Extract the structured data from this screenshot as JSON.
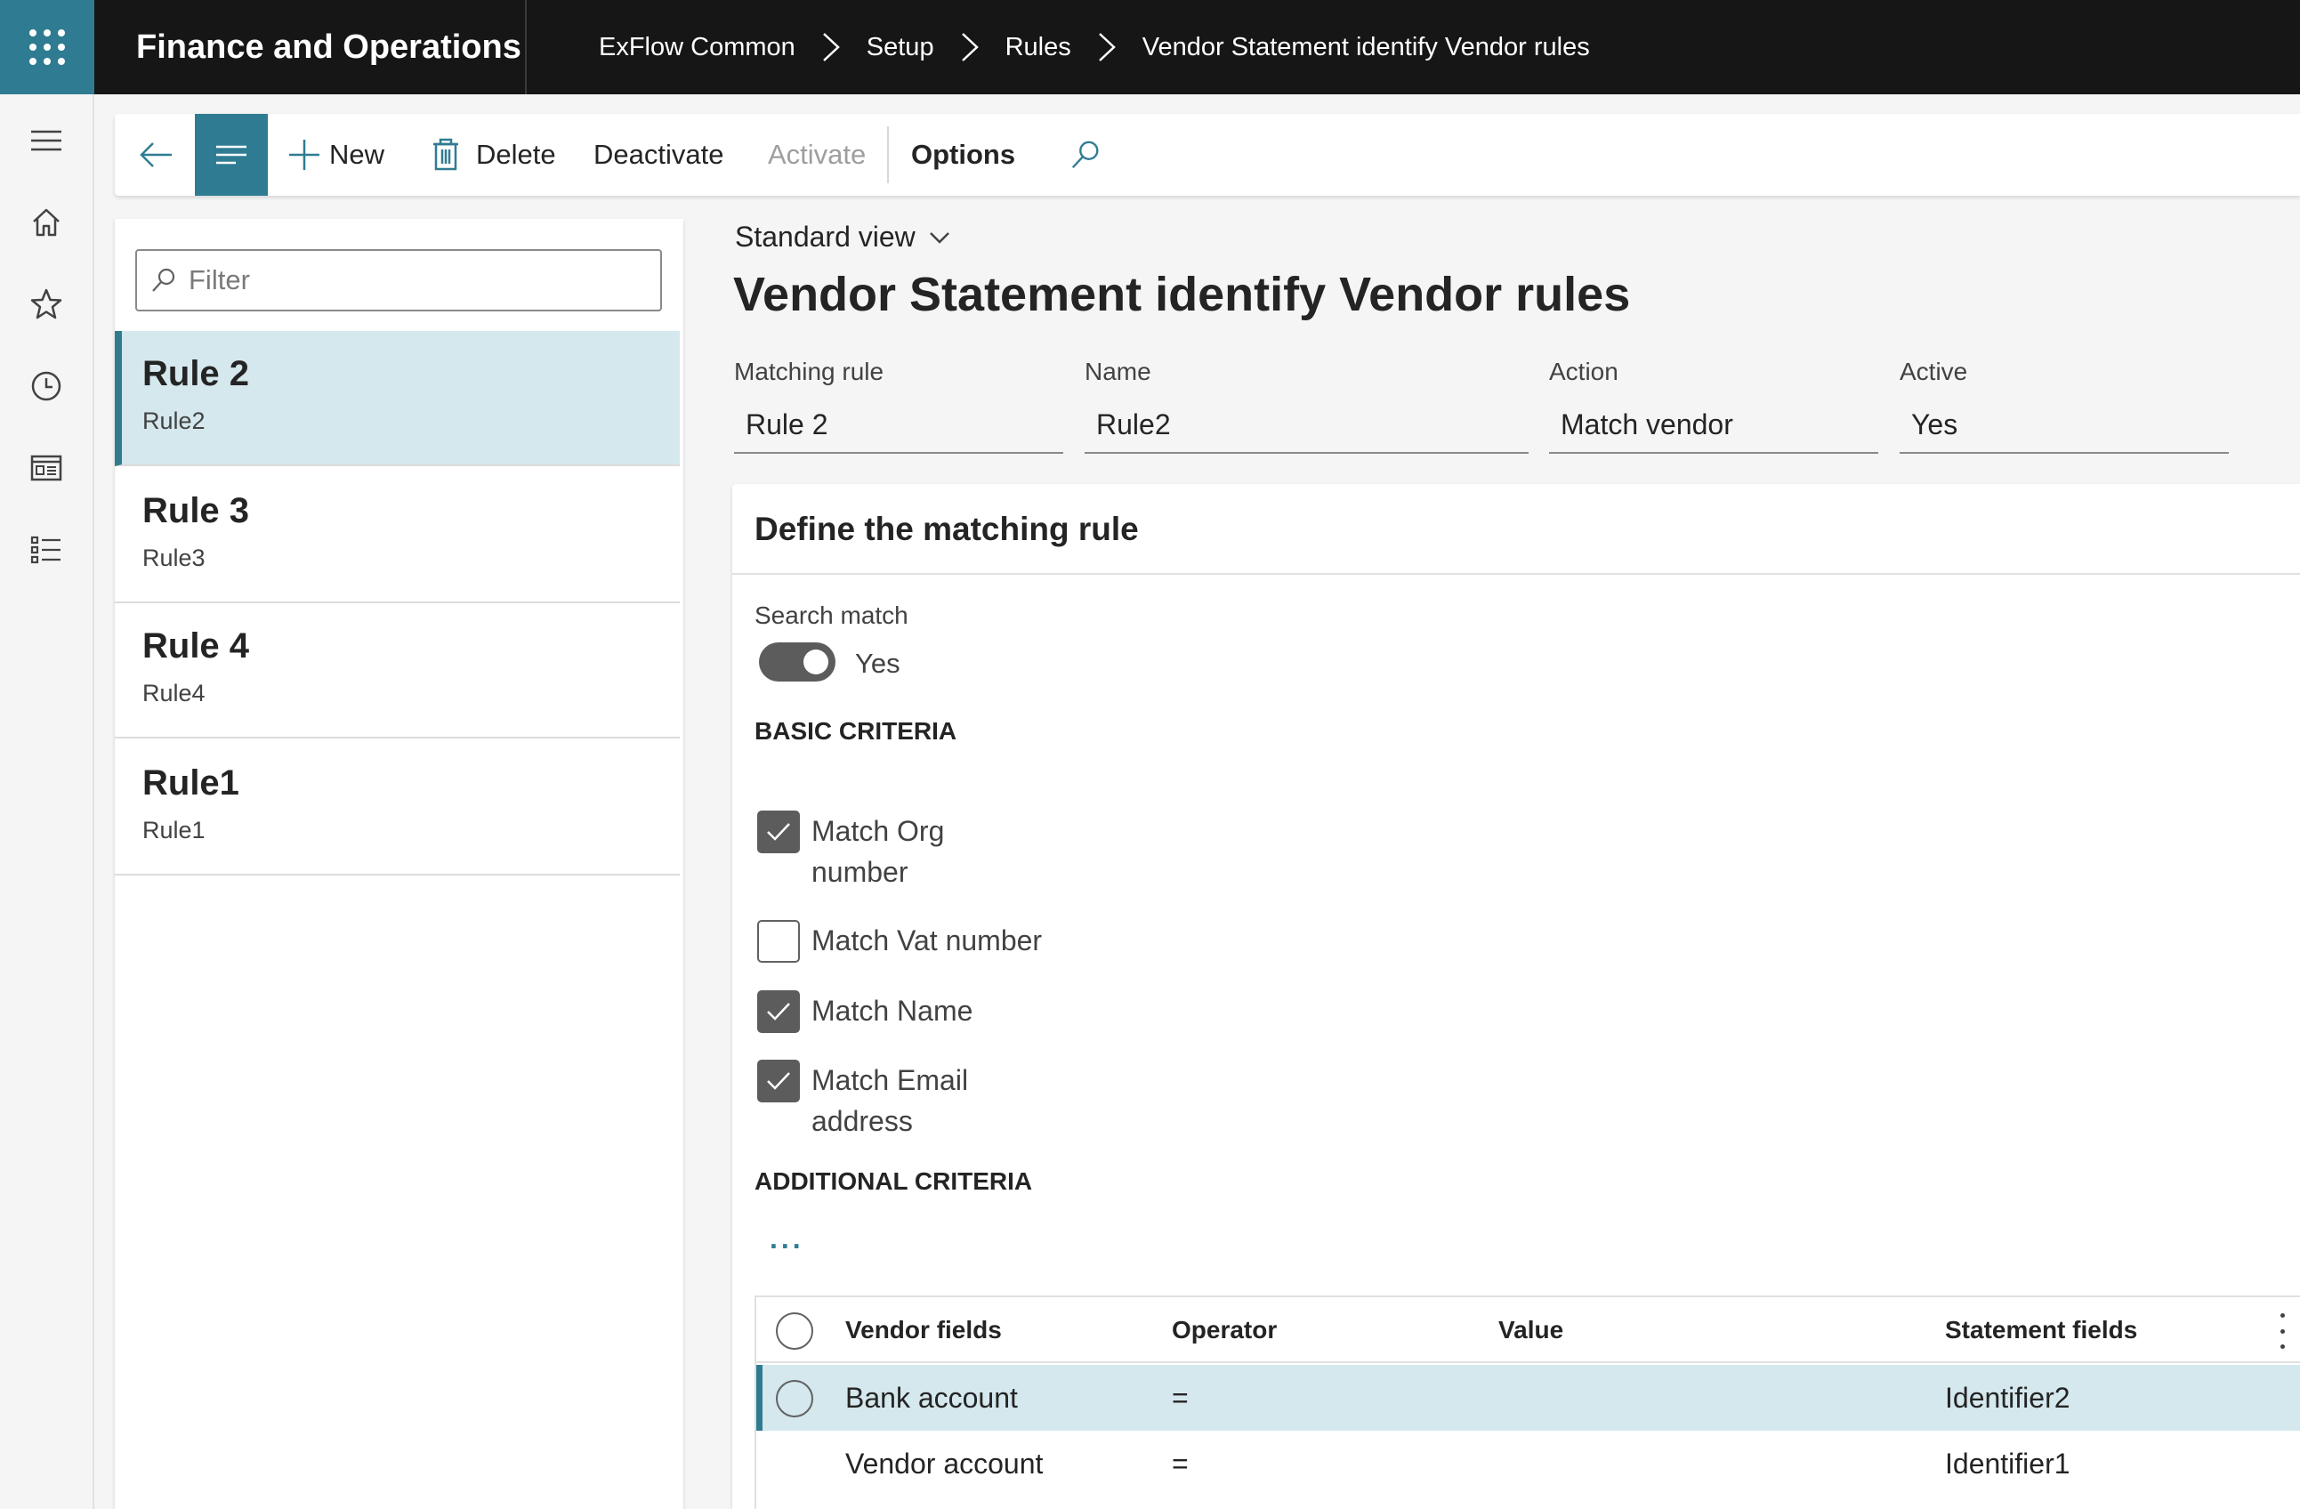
{
  "app": {
    "title": "Finance and Operations",
    "breadcrumb": [
      "ExFlow Common",
      "Setup",
      "Rules",
      "Vendor Statement identify Vendor rules"
    ]
  },
  "toolbar": {
    "new_label": "New",
    "delete_label": "Delete",
    "deactivate_label": "Deactivate",
    "activate_label": "Activate",
    "options_label": "Options"
  },
  "list": {
    "filter_placeholder": "Filter",
    "items": [
      {
        "title": "Rule 2",
        "subtitle": "Rule2",
        "selected": true
      },
      {
        "title": "Rule 3",
        "subtitle": "Rule3"
      },
      {
        "title": "Rule 4",
        "subtitle": "Rule4"
      },
      {
        "title": "Rule1",
        "subtitle": "Rule1"
      }
    ]
  },
  "main": {
    "view_selector": "Standard view",
    "page_title": "Vendor Statement identify Vendor rules",
    "fields": [
      {
        "label": "Matching rule",
        "value": "Rule 2"
      },
      {
        "label": "Name",
        "value": "Rule2"
      },
      {
        "label": "Action",
        "value": "Match vendor"
      },
      {
        "label": "Active",
        "value": "Yes"
      }
    ]
  },
  "section": {
    "title": "Define the matching rule",
    "search_match_label": "Search match",
    "search_match_value": "Yes",
    "search_match_on": true,
    "basic_criteria_title": "BASIC CRITERIA",
    "basic_criteria": [
      {
        "label": "Match Org number",
        "checked": true
      },
      {
        "label": "Match Vat number",
        "checked": false
      },
      {
        "label": "Match Name",
        "checked": true
      },
      {
        "label": "Match Email address",
        "checked": true
      }
    ],
    "additional_criteria_title": "ADDITIONAL CRITERIA",
    "more_label": "...",
    "grid": {
      "columns": [
        "Vendor fields",
        "Operator",
        "Value",
        "Statement fields"
      ],
      "rows": [
        {
          "vendor_field": "Bank account",
          "operator": "=",
          "value": "",
          "statement_field": "Identifier2",
          "selected": true
        },
        {
          "vendor_field": "Vendor account",
          "operator": "=",
          "value": "",
          "statement_field": "Identifier1"
        }
      ]
    }
  },
  "colors": {
    "accent": "#2f7c92",
    "topbar": "#161616",
    "selected_row": "#d4e8ee"
  }
}
